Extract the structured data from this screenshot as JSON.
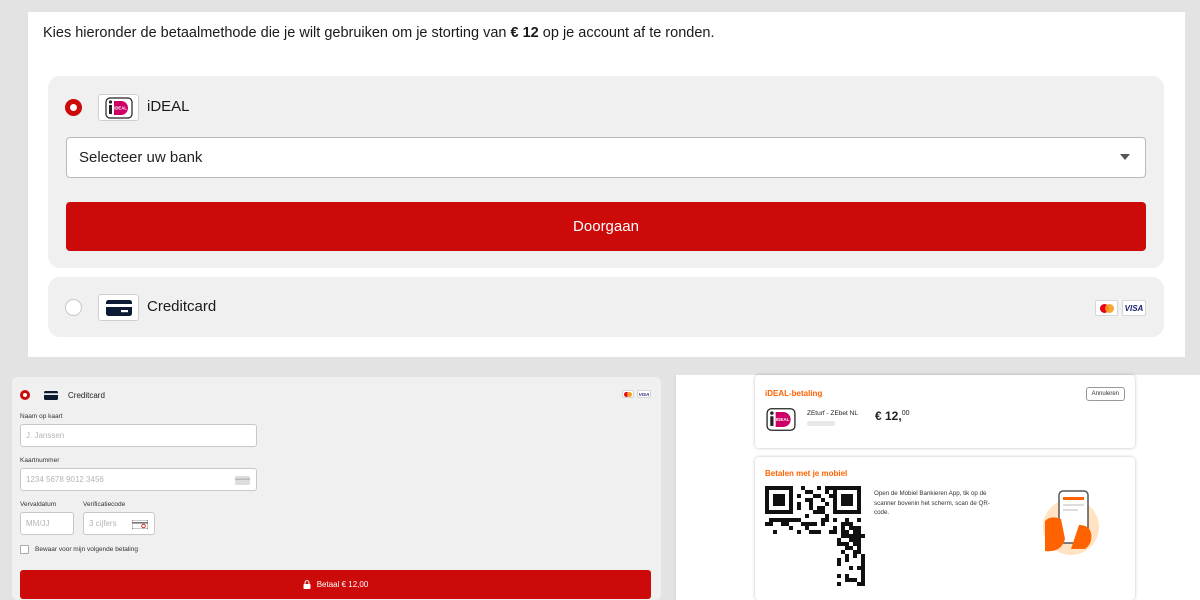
{
  "intro": {
    "text_before": "Kies hieronder de betaalmethode die je wilt gebruiken om je storting van",
    "amount": "€ 12",
    "text_after": "op je account af te ronden."
  },
  "ideal": {
    "label": "iDEAL",
    "logo_text": "iDEAL",
    "bank_select_placeholder": "Selecteer uw bank",
    "continue_label": "Doorgaan"
  },
  "creditcard": {
    "label": "Creditcard",
    "card_brands": [
      "Mastercard",
      "VISA"
    ],
    "visa_label": "VISA"
  },
  "cc_form": {
    "title": "Creditcard",
    "name_label": "Naam op kaart",
    "name_placeholder": "J. Janssen",
    "number_label": "Kaartnummer",
    "number_placeholder": "1234 5678 9012 3456",
    "expiry_label": "Vervaldatum",
    "expiry_placeholder": "MM/JJ",
    "cvc_label": "Verificatiecode",
    "cvc_placeholder": "3 cijfers",
    "save_label": "Bewaar voor mijn volgende betaling",
    "pay_label": "Betaal € 12,00"
  },
  "ideal_payment": {
    "title": "iDEAL-betaling",
    "cancel_label": "Annuleren",
    "merchant": "ZEturf - ZEbet NL",
    "amount_main": "€ 12,",
    "amount_cents": "00",
    "mobile_title": "Betalen met je mobiel",
    "mobile_instructions": "Open de Mobiel Bankieren App, tik op de scanner bovenin het scherm, scan de QR-code."
  },
  "colors": {
    "accent_red": "#cc0a0a",
    "ideal_pink": "#cc0066",
    "ing_orange": "#ff6200"
  }
}
